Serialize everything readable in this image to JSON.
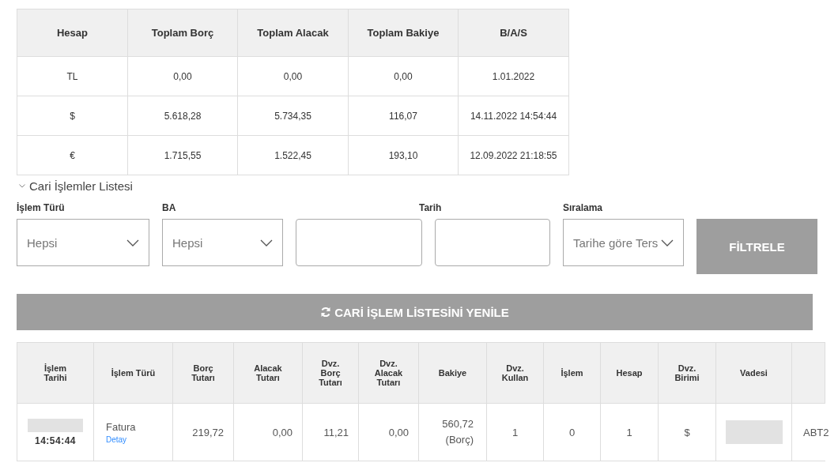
{
  "summary": {
    "columns": [
      "Hesap",
      "Toplam Borç",
      "Toplam Alacak",
      "Toplam Bakiye",
      "B/A/S"
    ],
    "rows": [
      [
        "TL",
        "0,00",
        "0,00",
        "0,00",
        "1.01.2022"
      ],
      [
        "$",
        "5.618,28",
        "5.734,35",
        "116,07",
        "14.11.2022 14:54:44"
      ],
      [
        "€",
        "1.715,55",
        "1.522,45",
        "193,10",
        "12.09.2022 21:18:55"
      ]
    ]
  },
  "section": {
    "title": "Cari İşlemler Listesi",
    "expanded": true
  },
  "filters": [
    {
      "label": "İşlem Türü",
      "kind": "select",
      "value": "Hepsi"
    },
    {
      "label": "BA",
      "kind": "select",
      "value": "Hepsi"
    },
    {
      "kind": "input"
    },
    {
      "label": "Tarih",
      "kind": "input"
    },
    {
      "label": "Sıralama",
      "kind": "select",
      "value": "Tarihe göre Ters"
    }
  ],
  "filter_button": "FİLTRELE",
  "refresh_button": "CARİ İŞLEM LİSTESİNİ YENİLE",
  "transactions": {
    "columns": [
      "İşlem\nTarihi",
      "İşlem Türü",
      "Borç\nTutarı",
      "Alacak\nTutarı",
      "Dvz.\nBorç\nTutarı",
      "Dvz.\nAlacak\nTutarı",
      "Bakiye",
      "Dvz.\nKullan",
      "İşlem",
      "Hesap",
      "Dvz.\nBirimi",
      "Vadesi"
    ],
    "rows": [
      [
        {
          "kind": "redacted_time",
          "text": "14:54:44"
        },
        {
          "kind": "link_text",
          "text": "Fatura",
          "link": "Detay"
        },
        {
          "kind": "number",
          "text": "219,72"
        },
        {
          "kind": "number",
          "text": "0,00"
        },
        {
          "kind": "number",
          "text": "11,21"
        },
        {
          "kind": "number",
          "text": "0,00"
        },
        {
          "kind": "two_line",
          "text": "560,72",
          "note": "(Borç)"
        },
        {
          "kind": "text",
          "text": "1"
        },
        {
          "kind": "text",
          "text": "0"
        },
        {
          "kind": "text",
          "text": "1"
        },
        {
          "kind": "text",
          "text": "$"
        },
        {
          "kind": "redacted"
        },
        {
          "kind": "clipped",
          "text": "ABT2"
        }
      ]
    ]
  }
}
